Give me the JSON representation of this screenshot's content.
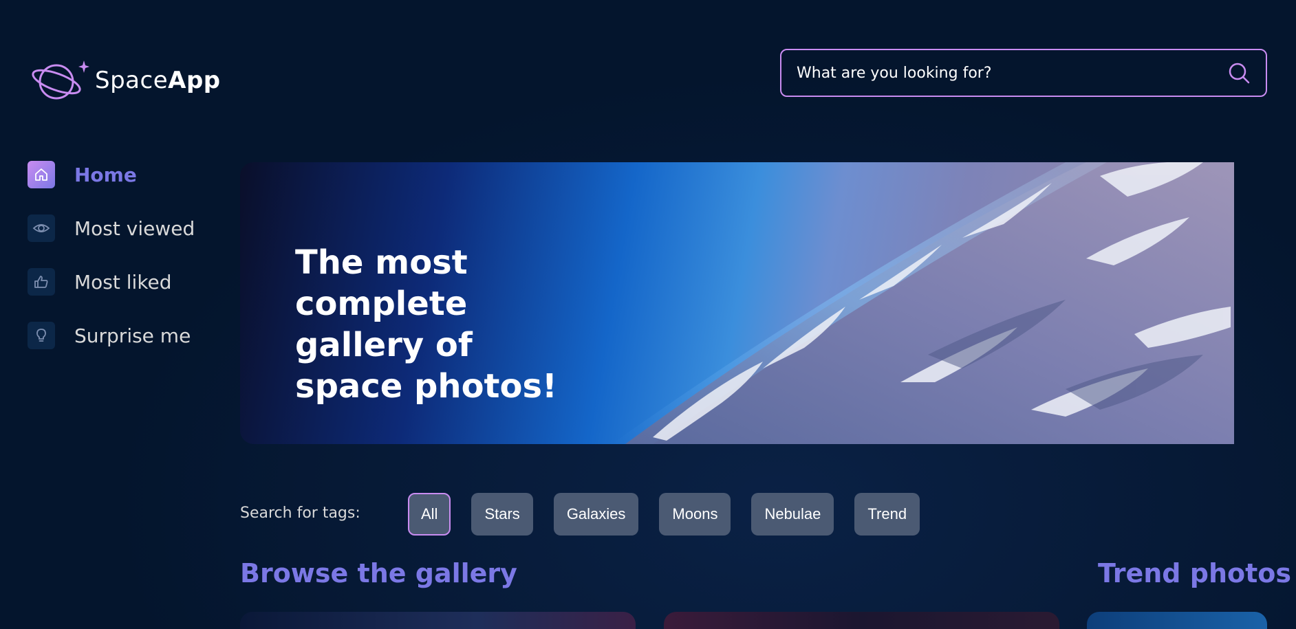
{
  "header": {
    "logo": {
      "text_light": "Space",
      "text_bold": "App"
    },
    "search": {
      "placeholder": "What are you looking for?"
    }
  },
  "sidebar": {
    "items": [
      {
        "label": "Home",
        "icon": "home-icon",
        "active": true
      },
      {
        "label": "Most viewed",
        "icon": "eye-icon",
        "active": false
      },
      {
        "label": "Most liked",
        "icon": "thumbs-up-icon",
        "active": false
      },
      {
        "label": "Surprise me",
        "icon": "lightbulb-icon",
        "active": false
      }
    ]
  },
  "banner": {
    "title": "The most complete gallery of space photos!"
  },
  "tags": {
    "label": "Search for tags:",
    "items": [
      "All",
      "Stars",
      "Galaxies",
      "Moons",
      "Nebulae",
      "Trend"
    ],
    "selected": "All"
  },
  "sections": {
    "browse_title": "Browse the gallery",
    "trend_title": "Trend photos"
  },
  "colors": {
    "background": "#04152d",
    "accent_purple": "#7b78e5",
    "accent_pink": "#c98cf1",
    "tag_bg": "#4b5a73"
  }
}
